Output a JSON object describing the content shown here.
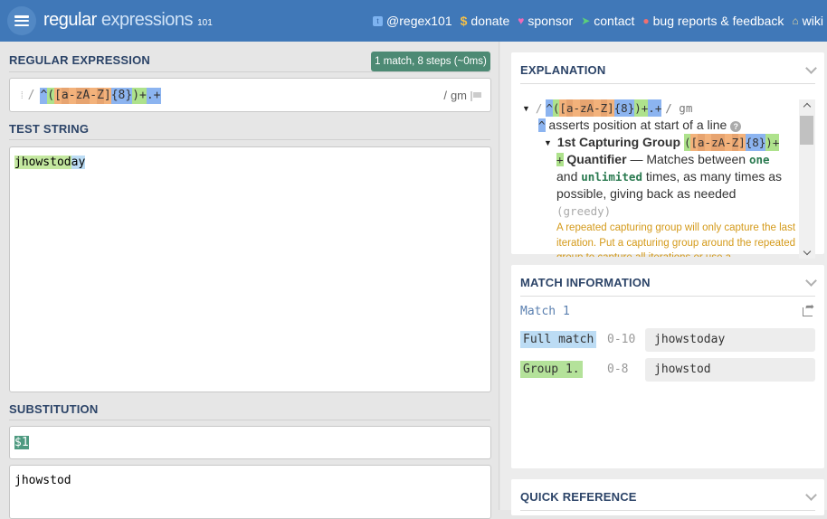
{
  "header": {
    "logo": {
      "part1": "regular",
      "part2": " expressions",
      "part3": "101"
    },
    "nav": [
      {
        "icon": "twitter-icon",
        "glyph": "✉",
        "label": "@regex101"
      },
      {
        "icon": "dollar-icon",
        "glyph": "$",
        "label": "donate"
      },
      {
        "icon": "heart-icon",
        "glyph": "♥",
        "label": "sponsor"
      },
      {
        "icon": "paper-plane-icon",
        "glyph": "➤",
        "label": "contact"
      },
      {
        "icon": "github-icon",
        "glyph": "●",
        "label": "bug reports & feedback"
      },
      {
        "icon": "bank-icon",
        "glyph": "⌂",
        "label": "wiki"
      }
    ]
  },
  "regex_section": {
    "title": "REGULAR EXPRESSION",
    "status_badge": "1 match, 8 steps (~0ms)",
    "delimiter_open": "/",
    "delimiter_close": "/",
    "flags": "gm",
    "pattern": "^([a-zA-Z]{8})+.+",
    "tokens": [
      {
        "text": "^",
        "color": "blue"
      },
      {
        "text": "(",
        "color": "green"
      },
      {
        "text": "[",
        "color": "orange"
      },
      {
        "text": "a",
        "color": "orange2"
      },
      {
        "text": "-",
        "color": "orange"
      },
      {
        "text": "z",
        "color": "orange2"
      },
      {
        "text": "A",
        "color": "orange2"
      },
      {
        "text": "-",
        "color": "orange"
      },
      {
        "text": "Z",
        "color": "orange2"
      },
      {
        "text": "]",
        "color": "orange"
      },
      {
        "text": "{8}",
        "color": "blue"
      },
      {
        "text": ")+",
        "color": "green"
      },
      {
        "text": ".+",
        "color": "blue"
      }
    ]
  },
  "test_section": {
    "title": "TEST STRING",
    "text_group": "jhowstod",
    "text_rest": "ay"
  },
  "substitution_section": {
    "title": "SUBSTITUTION",
    "value": "$1",
    "result": "jhowstod"
  },
  "explanation": {
    "title": "EXPLANATION",
    "root_delim_open": "/",
    "root_delim_close": "/ gm",
    "anchor_token": "^",
    "anchor_desc": "asserts position at start of a line",
    "group_title": "1st Capturing Group",
    "quantifier_token": "+",
    "quantifier_title": "Quantifier",
    "quantifier_desc_1": "— Matches between",
    "kw_one": "one",
    "and": "and",
    "kw_unlimited": "unlimited",
    "quantifier_desc_2": "times, as many times as",
    "quantifier_desc_3": "possible, giving back as needed",
    "greedy": "(greedy)",
    "warning": "A repeated capturing group will only capture the last iteration. Put a capturing group around the repeated group to capture all iterations or use a"
  },
  "match_info": {
    "title": "MATCH INFORMATION",
    "match_label": "Match 1",
    "rows": [
      {
        "tag": "Full match",
        "range": "0-10",
        "value": "jhowstoday"
      },
      {
        "tag": "Group 1.",
        "range": "0-8",
        "value": "jhowstod"
      }
    ]
  },
  "quick_reference": {
    "title": "QUICK REFERENCE"
  },
  "colors": {
    "header_bg": "#4078b8",
    "badge_bg": "#4d8a74",
    "token_blue": "#8cb4f0",
    "token_green": "#aee28c",
    "token_orange": "#f3b27b",
    "warning_text": "#d49a1a"
  }
}
